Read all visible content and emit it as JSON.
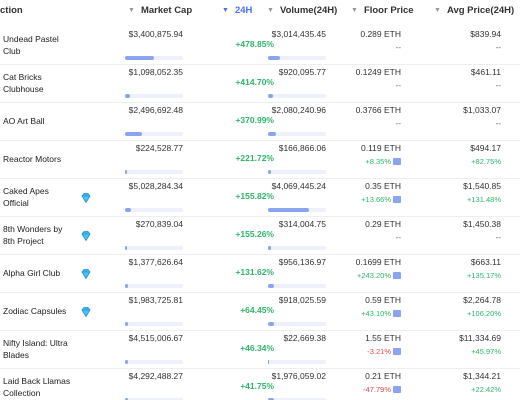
{
  "header": {
    "collection": "ction",
    "market_cap": "Market Cap",
    "change_24h": "24H",
    "volume": "Volume(24H)",
    "floor_price": "Floor Price",
    "avg_price": "Avg Price(24H)"
  },
  "rows": [
    {
      "name": "Undead Pastel Club",
      "gem": false,
      "market_cap": "$3,400,875.94",
      "mcap_fraction": 0.5,
      "change": "+478.85%",
      "volume": "$3,014,435.45",
      "vol_fraction": 0.2,
      "floor": "0.289 ETH",
      "floor_sub": "--",
      "floor_sub_class": "dash",
      "floor_chart": false,
      "avg": "$839.94",
      "avg_sub": "--",
      "avg_sub_class": "dash"
    },
    {
      "name": "Cat Bricks Clubhouse",
      "gem": false,
      "market_cap": "$1,098,052.35",
      "mcap_fraction": 0.08,
      "change": "+414.70%",
      "volume": "$920,095.77",
      "vol_fraction": 0.08,
      "floor": "0.1249 ETH",
      "floor_sub": "--",
      "floor_sub_class": "dash",
      "floor_chart": false,
      "avg": "$461.11",
      "avg_sub": "--",
      "avg_sub_class": "dash"
    },
    {
      "name": "AO Art Ball",
      "gem": false,
      "market_cap": "$2,496,692.48",
      "mcap_fraction": 0.3,
      "change": "+370.99%",
      "volume": "$2,080,240.96",
      "vol_fraction": 0.14,
      "floor": "0.3766 ETH",
      "floor_sub": "--",
      "floor_sub_class": "dash",
      "floor_chart": false,
      "avg": "$1,033.07",
      "avg_sub": "--",
      "avg_sub_class": "dash"
    },
    {
      "name": "Reactor Motors",
      "gem": false,
      "market_cap": "$224,528.77",
      "mcap_fraction": 0.03,
      "change": "+221.72%",
      "volume": "$166,866.06",
      "vol_fraction": 0.05,
      "floor": "0.119 ETH",
      "floor_sub": "+8.35%",
      "floor_sub_class": "up",
      "floor_chart": true,
      "avg": "$494.17",
      "avg_sub": "+82.75%",
      "avg_sub_class": "up"
    },
    {
      "name": "Caked Apes Official",
      "gem": true,
      "market_cap": "$5,028,284.34",
      "mcap_fraction": 0.1,
      "change": "+155.82%",
      "volume": "$4,069,445.24",
      "vol_fraction": 0.7,
      "floor": "0.35 ETH",
      "floor_sub": "+13.66%",
      "floor_sub_class": "up",
      "floor_chart": true,
      "avg": "$1,540.85",
      "avg_sub": "+131.48%",
      "avg_sub_class": "up"
    },
    {
      "name": "8th Wonders by 8th Project",
      "gem": true,
      "market_cap": "$270,839.04",
      "mcap_fraction": 0.03,
      "change": "+155.26%",
      "volume": "$314,004.75",
      "vol_fraction": 0.05,
      "floor": "0.29 ETH",
      "floor_sub": "--",
      "floor_sub_class": "dash",
      "floor_chart": false,
      "avg": "$1,450.38",
      "avg_sub": "--",
      "avg_sub_class": "dash"
    },
    {
      "name": "Alpha Girl Club",
      "gem": true,
      "market_cap": "$1,377,626.64",
      "mcap_fraction": 0.05,
      "change": "+131.62%",
      "volume": "$956,136.97",
      "vol_fraction": 0.1,
      "floor": "0.1699 ETH",
      "floor_sub": "+243.20%",
      "floor_sub_class": "up",
      "floor_chart": true,
      "avg": "$663.11",
      "avg_sub": "+135.17%",
      "avg_sub_class": "up"
    },
    {
      "name": "Zodiac Capsules",
      "gem": true,
      "market_cap": "$1,983,725.81",
      "mcap_fraction": 0.06,
      "change": "+64.45%",
      "volume": "$918,025.59",
      "vol_fraction": 0.1,
      "floor": "0.59 ETH",
      "floor_sub": "+43.10%",
      "floor_sub_class": "up",
      "floor_chart": true,
      "avg": "$2,264.78",
      "avg_sub": "+106.20%",
      "avg_sub_class": "up"
    },
    {
      "name": "Nifty Island: Ultra Blades",
      "gem": false,
      "market_cap": "$4,515,006.67",
      "mcap_fraction": 0.05,
      "change": "+46.34%",
      "volume": "$22,669.38",
      "vol_fraction": 0.02,
      "floor": "1.55 ETH",
      "floor_sub": "-3.21%",
      "floor_sub_class": "down",
      "floor_chart": true,
      "avg": "$11,334.69",
      "avg_sub": "+45.97%",
      "avg_sub_class": "up"
    },
    {
      "name": "Laid Back Llamas Collection",
      "gem": false,
      "market_cap": "$4,292,488.27",
      "mcap_fraction": 0.06,
      "change": "+41.75%",
      "volume": "$1,976,059.02",
      "vol_fraction": 0.1,
      "floor": "0.21 ETH",
      "floor_sub": "-47.79%",
      "floor_sub_class": "down",
      "floor_chart": true,
      "avg": "$1,344.21",
      "avg_sub": "+22.42%",
      "avg_sub_class": "up"
    }
  ]
}
